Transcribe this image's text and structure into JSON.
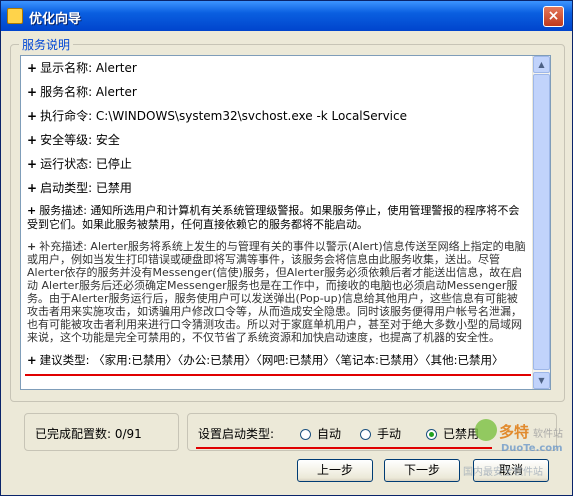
{
  "window": {
    "title": "优化向导",
    "close_label": "×"
  },
  "service_group": {
    "label": "服务说明"
  },
  "lines": [
    {
      "text": "显示名称: Alerter"
    },
    {
      "text": "服务名称: Alerter"
    },
    {
      "text": "执行命令: C:\\WINDOWS\\system32\\svchost.exe -k LocalService"
    },
    {
      "text": "安全等级: 安全"
    },
    {
      "text": "运行状态: 已停止"
    },
    {
      "text": "启动类型: 已禁用"
    },
    {
      "text": "服务描述: 通知所选用户和计算机有关系统管理级警报。如果服务停止，使用管理警报的程序将不会受到它们。如果此服务被禁用，任何直接依赖它的服务都将不能启动。"
    },
    {
      "text": "补充描述: Alerter服务将系统上发生的与管理有关的事件以警示(Alert)信息传送至网络上指定的电脑或用户，例如当发生打印错误或硬盘即将写满等事件，该服务会将信息由此服务收集，送出。尽管Alerter依存的服务并没有Messenger(信使)服务，但Alerter服务必须依赖后者才能送出信息，故在启动 Alerter服务后还必须确定Messenger服务也是在工作中，而接收的电脑也必须启动Messenger服务。由于Alerter服务运行后，服务使用户可以发送弹出(Pop-up)信息给其他用户，这些信息有可能被攻击者用来实施攻击，如诱骗用户修改口令等，从而造成安全隐患。同时该服务便得用户帐号名泄漏，也有可能被攻击者利用来进行口令猜测攻击。所以对于家庭单机用户，甚至对于绝大多数小型的局域网来说，这个功能是完全可禁用的，不仅节省了系统资源和加快启动速度，也提高了机器的安全性。"
    },
    {
      "text": "建议类型: 〈家用:已禁用〉〈办公:已禁用〉〈网吧:已禁用〉〈笔记本:已禁用〉〈其他:已禁用〉"
    }
  ],
  "scrollbar": {
    "up": "▲",
    "down": "▼"
  },
  "progress": {
    "text": "已完成配置数: 0/91"
  },
  "startup": {
    "label": "设置启动类型:",
    "options": [
      {
        "label": "自动",
        "selected": false
      },
      {
        "label": "手动",
        "selected": false
      },
      {
        "label": "已禁用",
        "selected": true
      }
    ]
  },
  "buttons": {
    "prev": "上一步",
    "next": "下一步",
    "cancel": "取消"
  },
  "watermark": {
    "brand": "多特",
    "sub": "软件站",
    "site": "DuoTe.com",
    "caption": "国内最安全软件站"
  },
  "colors": {
    "title_bar": "#0a5fe0",
    "group_label": "#0046d5",
    "highlight_line": "#e00000",
    "selected_radio": "#21a121"
  }
}
